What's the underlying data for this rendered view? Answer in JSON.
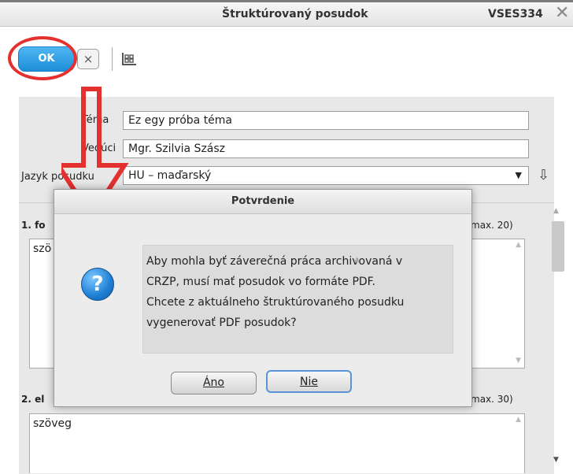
{
  "window": {
    "title": "Štruktúrovaný posudok",
    "code": "VSES334"
  },
  "toolbar": {
    "ok_label": "OK",
    "cancel_glyph": "×",
    "grid_icon": "grid-icon"
  },
  "form": {
    "tema_label": "Téma",
    "tema_value": "Ez egy próba téma",
    "veduci_label": "Vedúci",
    "veduci_value": "Mgr. Szilvia Szász",
    "jazyk_label": "Jazyk posudku",
    "jazyk_value": "HU – maďarský"
  },
  "sections": [
    {
      "heading": "1. fo",
      "max": "max. 20)",
      "text": "szö"
    },
    {
      "heading": "2. el",
      "max": "max. 30)",
      "text": "szöveg"
    }
  ],
  "dialog": {
    "title": "Potvrdenie",
    "message_lines": [
      "Aby mohla byť záverečná práca archivovaná v",
      "CRZP, musí mať posudok vo formáte PDF.",
      "Chcete z aktuálneho štruktúrovaného posudku",
      "vygenerovať PDF posudok?"
    ],
    "yes_label": "Áno",
    "no_label": "Nie"
  },
  "colors": {
    "annotation": "#e53030",
    "ok_button": "#1c8fd8"
  }
}
